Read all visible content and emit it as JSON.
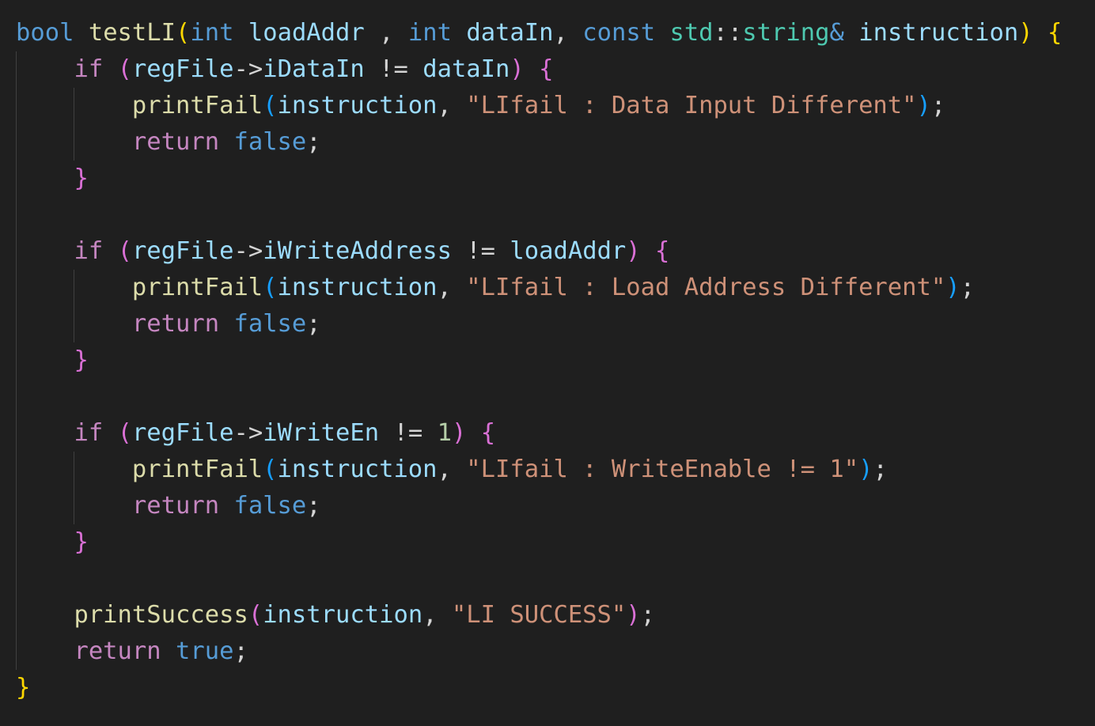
{
  "lines": [
    [
      {
        "t": "bool",
        "c": "kw-bl"
      },
      {
        "t": " ",
        "c": "plain"
      },
      {
        "t": "testLI",
        "c": "fn"
      },
      {
        "t": "(",
        "c": "b1"
      },
      {
        "t": "int",
        "c": "kw-bl"
      },
      {
        "t": " ",
        "c": "plain"
      },
      {
        "t": "loadAddr",
        "c": "var"
      },
      {
        "t": " , ",
        "c": "plain"
      },
      {
        "t": "int",
        "c": "kw-bl"
      },
      {
        "t": " ",
        "c": "plain"
      },
      {
        "t": "dataIn",
        "c": "var"
      },
      {
        "t": ", ",
        "c": "plain"
      },
      {
        "t": "const",
        "c": "kw-bl"
      },
      {
        "t": " ",
        "c": "plain"
      },
      {
        "t": "std",
        "c": "type"
      },
      {
        "t": "::",
        "c": "plain"
      },
      {
        "t": "string",
        "c": "type"
      },
      {
        "t": "&",
        "c": "kw-bl"
      },
      {
        "t": " ",
        "c": "plain"
      },
      {
        "t": "instruction",
        "c": "var"
      },
      {
        "t": ")",
        "c": "b1"
      },
      {
        "t": " ",
        "c": "plain"
      },
      {
        "t": "{",
        "c": "b1"
      }
    ],
    [
      {
        "t": "    ",
        "c": "plain"
      },
      {
        "t": "if",
        "c": "kw-pu"
      },
      {
        "t": " ",
        "c": "plain"
      },
      {
        "t": "(",
        "c": "b2"
      },
      {
        "t": "regFile",
        "c": "var"
      },
      {
        "t": "->",
        "c": "plain"
      },
      {
        "t": "iDataIn",
        "c": "var"
      },
      {
        "t": " != ",
        "c": "plain"
      },
      {
        "t": "dataIn",
        "c": "var"
      },
      {
        "t": ")",
        "c": "b2"
      },
      {
        "t": " ",
        "c": "plain"
      },
      {
        "t": "{",
        "c": "b2"
      }
    ],
    [
      {
        "t": "        ",
        "c": "plain"
      },
      {
        "t": "printFail",
        "c": "fn"
      },
      {
        "t": "(",
        "c": "b3"
      },
      {
        "t": "instruction",
        "c": "var"
      },
      {
        "t": ", ",
        "c": "plain"
      },
      {
        "t": "\"LIfail : Data Input Different\"",
        "c": "str"
      },
      {
        "t": ")",
        "c": "b3"
      },
      {
        "t": ";",
        "c": "plain"
      }
    ],
    [
      {
        "t": "        ",
        "c": "plain"
      },
      {
        "t": "return",
        "c": "kw-pu"
      },
      {
        "t": " ",
        "c": "plain"
      },
      {
        "t": "false",
        "c": "kw-bl"
      },
      {
        "t": ";",
        "c": "plain"
      }
    ],
    [
      {
        "t": "    ",
        "c": "plain"
      },
      {
        "t": "}",
        "c": "b2"
      }
    ],
    [],
    [
      {
        "t": "    ",
        "c": "plain"
      },
      {
        "t": "if",
        "c": "kw-pu"
      },
      {
        "t": " ",
        "c": "plain"
      },
      {
        "t": "(",
        "c": "b2"
      },
      {
        "t": "regFile",
        "c": "var"
      },
      {
        "t": "->",
        "c": "plain"
      },
      {
        "t": "iWriteAddress",
        "c": "var"
      },
      {
        "t": " != ",
        "c": "plain"
      },
      {
        "t": "loadAddr",
        "c": "var"
      },
      {
        "t": ")",
        "c": "b2"
      },
      {
        "t": " ",
        "c": "plain"
      },
      {
        "t": "{",
        "c": "b2"
      }
    ],
    [
      {
        "t": "        ",
        "c": "plain"
      },
      {
        "t": "printFail",
        "c": "fn"
      },
      {
        "t": "(",
        "c": "b3"
      },
      {
        "t": "instruction",
        "c": "var"
      },
      {
        "t": ", ",
        "c": "plain"
      },
      {
        "t": "\"LIfail : Load Address Different\"",
        "c": "str"
      },
      {
        "t": ")",
        "c": "b3"
      },
      {
        "t": ";",
        "c": "plain"
      }
    ],
    [
      {
        "t": "        ",
        "c": "plain"
      },
      {
        "t": "return",
        "c": "kw-pu"
      },
      {
        "t": " ",
        "c": "plain"
      },
      {
        "t": "false",
        "c": "kw-bl"
      },
      {
        "t": ";",
        "c": "plain"
      }
    ],
    [
      {
        "t": "    ",
        "c": "plain"
      },
      {
        "t": "}",
        "c": "b2"
      }
    ],
    [],
    [
      {
        "t": "    ",
        "c": "plain"
      },
      {
        "t": "if",
        "c": "kw-pu"
      },
      {
        "t": " ",
        "c": "plain"
      },
      {
        "t": "(",
        "c": "b2"
      },
      {
        "t": "regFile",
        "c": "var"
      },
      {
        "t": "->",
        "c": "plain"
      },
      {
        "t": "iWriteEn",
        "c": "var"
      },
      {
        "t": " != ",
        "c": "plain"
      },
      {
        "t": "1",
        "c": "num"
      },
      {
        "t": ")",
        "c": "b2"
      },
      {
        "t": " ",
        "c": "plain"
      },
      {
        "t": "{",
        "c": "b2"
      }
    ],
    [
      {
        "t": "        ",
        "c": "plain"
      },
      {
        "t": "printFail",
        "c": "fn"
      },
      {
        "t": "(",
        "c": "b3"
      },
      {
        "t": "instruction",
        "c": "var"
      },
      {
        "t": ", ",
        "c": "plain"
      },
      {
        "t": "\"LIfail : WriteEnable != 1\"",
        "c": "str"
      },
      {
        "t": ")",
        "c": "b3"
      },
      {
        "t": ";",
        "c": "plain"
      }
    ],
    [
      {
        "t": "        ",
        "c": "plain"
      },
      {
        "t": "return",
        "c": "kw-pu"
      },
      {
        "t": " ",
        "c": "plain"
      },
      {
        "t": "false",
        "c": "kw-bl"
      },
      {
        "t": ";",
        "c": "plain"
      }
    ],
    [
      {
        "t": "    ",
        "c": "plain"
      },
      {
        "t": "}",
        "c": "b2"
      }
    ],
    [],
    [
      {
        "t": "    ",
        "c": "plain"
      },
      {
        "t": "printSuccess",
        "c": "fn"
      },
      {
        "t": "(",
        "c": "b2"
      },
      {
        "t": "instruction",
        "c": "var"
      },
      {
        "t": ", ",
        "c": "plain"
      },
      {
        "t": "\"LI SUCCESS\"",
        "c": "str"
      },
      {
        "t": ")",
        "c": "b2"
      },
      {
        "t": ";",
        "c": "plain"
      }
    ],
    [
      {
        "t": "    ",
        "c": "plain"
      },
      {
        "t": "return",
        "c": "kw-pu"
      },
      {
        "t": " ",
        "c": "plain"
      },
      {
        "t": "true",
        "c": "kw-bl"
      },
      {
        "t": ";",
        "c": "plain"
      }
    ],
    [
      {
        "t": "}",
        "c": "b1"
      }
    ]
  ]
}
